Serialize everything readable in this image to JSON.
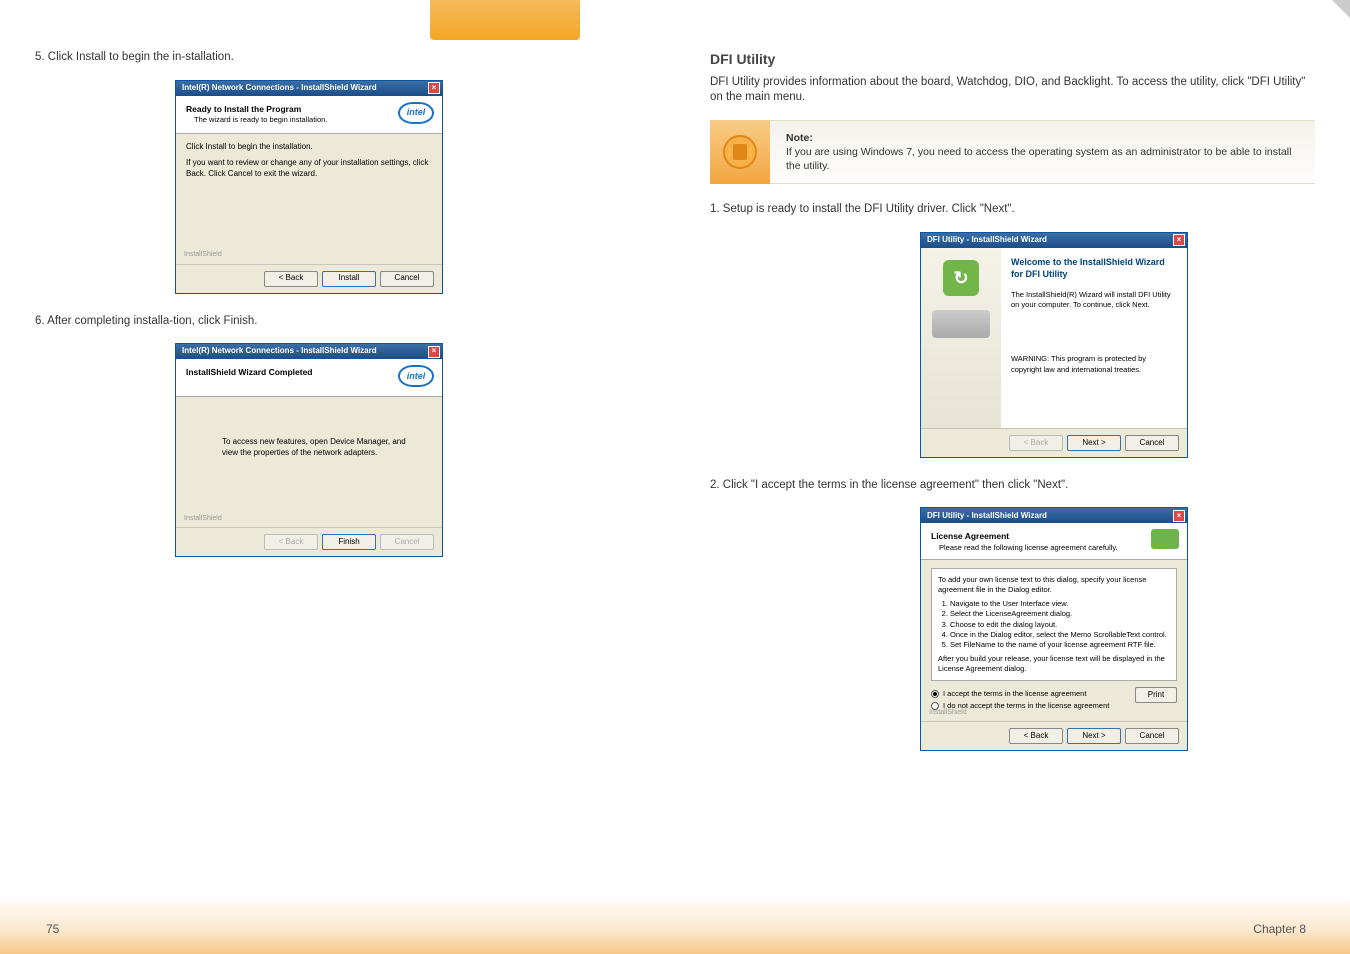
{
  "page": {
    "number": "75",
    "chapter": "Chapter 8"
  },
  "left": {
    "step5": "5. Click Install to begin the in-stallation.",
    "step6": "6. After completing installa-tion, click Finish.",
    "dlg1": {
      "title": "Intel(R) Network Connections - InstallShield Wizard",
      "h_bold": "Ready to Install the Program",
      "h_sub": "The wizard is ready to begin installation.",
      "body_line1": "Click Install to begin the installation.",
      "body_line2": "If you want to review or change any of your installation settings, click Back. Click Cancel to exit the wizard.",
      "ishield": "InstallShield",
      "btn_back": "< Back",
      "btn_install": "Install",
      "btn_cancel": "Cancel"
    },
    "dlg2": {
      "title": "Intel(R) Network Connections - InstallShield Wizard",
      "h_bold": "InstallShield Wizard Completed",
      "body": "To access new features, open Device Manager, and view the properties of the network adapters.",
      "ishield": "InstallShield",
      "btn_back": "< Back",
      "btn_finish": "Finish",
      "btn_cancel": "Cancel"
    }
  },
  "right": {
    "section_title": "DFI Utility",
    "intro": "DFI Utility provides information about the board, Watchdog, DIO, and Backlight. To access the utility, click \"DFI Utility\" on the main menu.",
    "note_label": "Note:",
    "note_text": "If you are using Windows 7, you need to access the operating system as an administrator to be able to install the utility.",
    "step1": "1. Setup is ready to install the DFI Utility driver. Click \"Next\".",
    "step2": "2. Click \"I accept the terms in the license agreement\" then click \"Next\".",
    "dlg3": {
      "title": "DFI Utility - InstallShield Wizard",
      "w_title": "Welcome to the InstallShield Wizard for DFI Utility",
      "line1": "The InstallShield(R) Wizard will install DFI Utility on your computer. To continue, click Next.",
      "warn": "WARNING: This program is protected by copyright law and international treaties.",
      "btn_back": "< Back",
      "btn_next": "Next >",
      "btn_cancel": "Cancel"
    },
    "dlg4": {
      "title": "DFI Utility - InstallShield Wizard",
      "h_bold": "License Agreement",
      "h_sub": "Please read the following license agreement carefully.",
      "lic_intro": "To add your own license text to this dialog, specify your license agreement file in the Dialog editor.",
      "lic1": "Navigate to the User Interface view.",
      "lic2": "Select the LicenseAgreement dialog.",
      "lic3": "Choose to edit the dialog layout.",
      "lic4": "Once in the Dialog editor, select the Memo ScrollableText control.",
      "lic5": "Set FileName to the name of your license agreement RTF file.",
      "lic_after": "After you build your release, your license text will be displayed in the License Agreement dialog.",
      "radio_accept": "I accept the terms in the license agreement",
      "radio_reject": "I do not accept the terms in the license agreement",
      "btn_print": "Print",
      "ishield": "InstallShield",
      "btn_back": "< Back",
      "btn_next": "Next >",
      "btn_cancel": "Cancel"
    }
  },
  "logo": {
    "intel": "intel"
  }
}
